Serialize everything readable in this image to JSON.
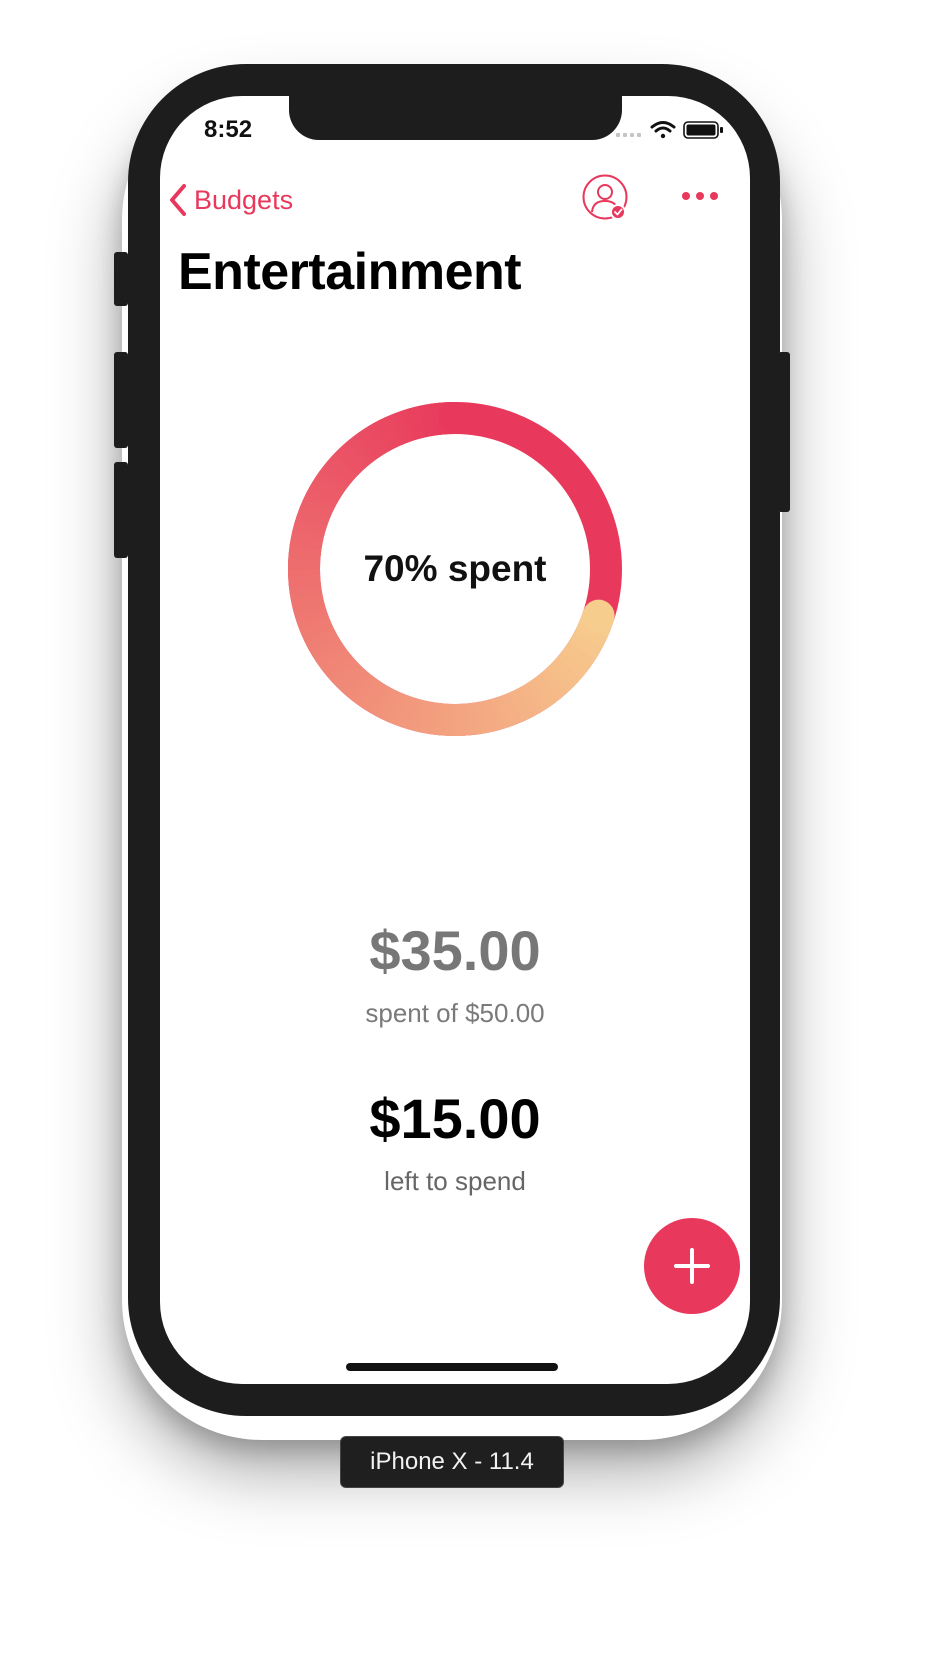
{
  "status_bar": {
    "time": "8:52"
  },
  "nav": {
    "back_label": "Budgets"
  },
  "header": {
    "title": "Entertainment"
  },
  "ring": {
    "label": "70% spent",
    "percent": 70,
    "gradient_start": "#f7cd8e",
    "gradient_end": "#e8385c"
  },
  "summary": {
    "spent_amount": "$35.00",
    "spent_caption": "spent of $50.00",
    "left_amount": "$15.00",
    "left_caption": "left to spend"
  },
  "fab": {
    "icon": "plus-icon"
  },
  "device": {
    "label": "iPhone X - 11.4"
  },
  "colors": {
    "accent": "#e8385c",
    "muted_text": "#777777"
  }
}
